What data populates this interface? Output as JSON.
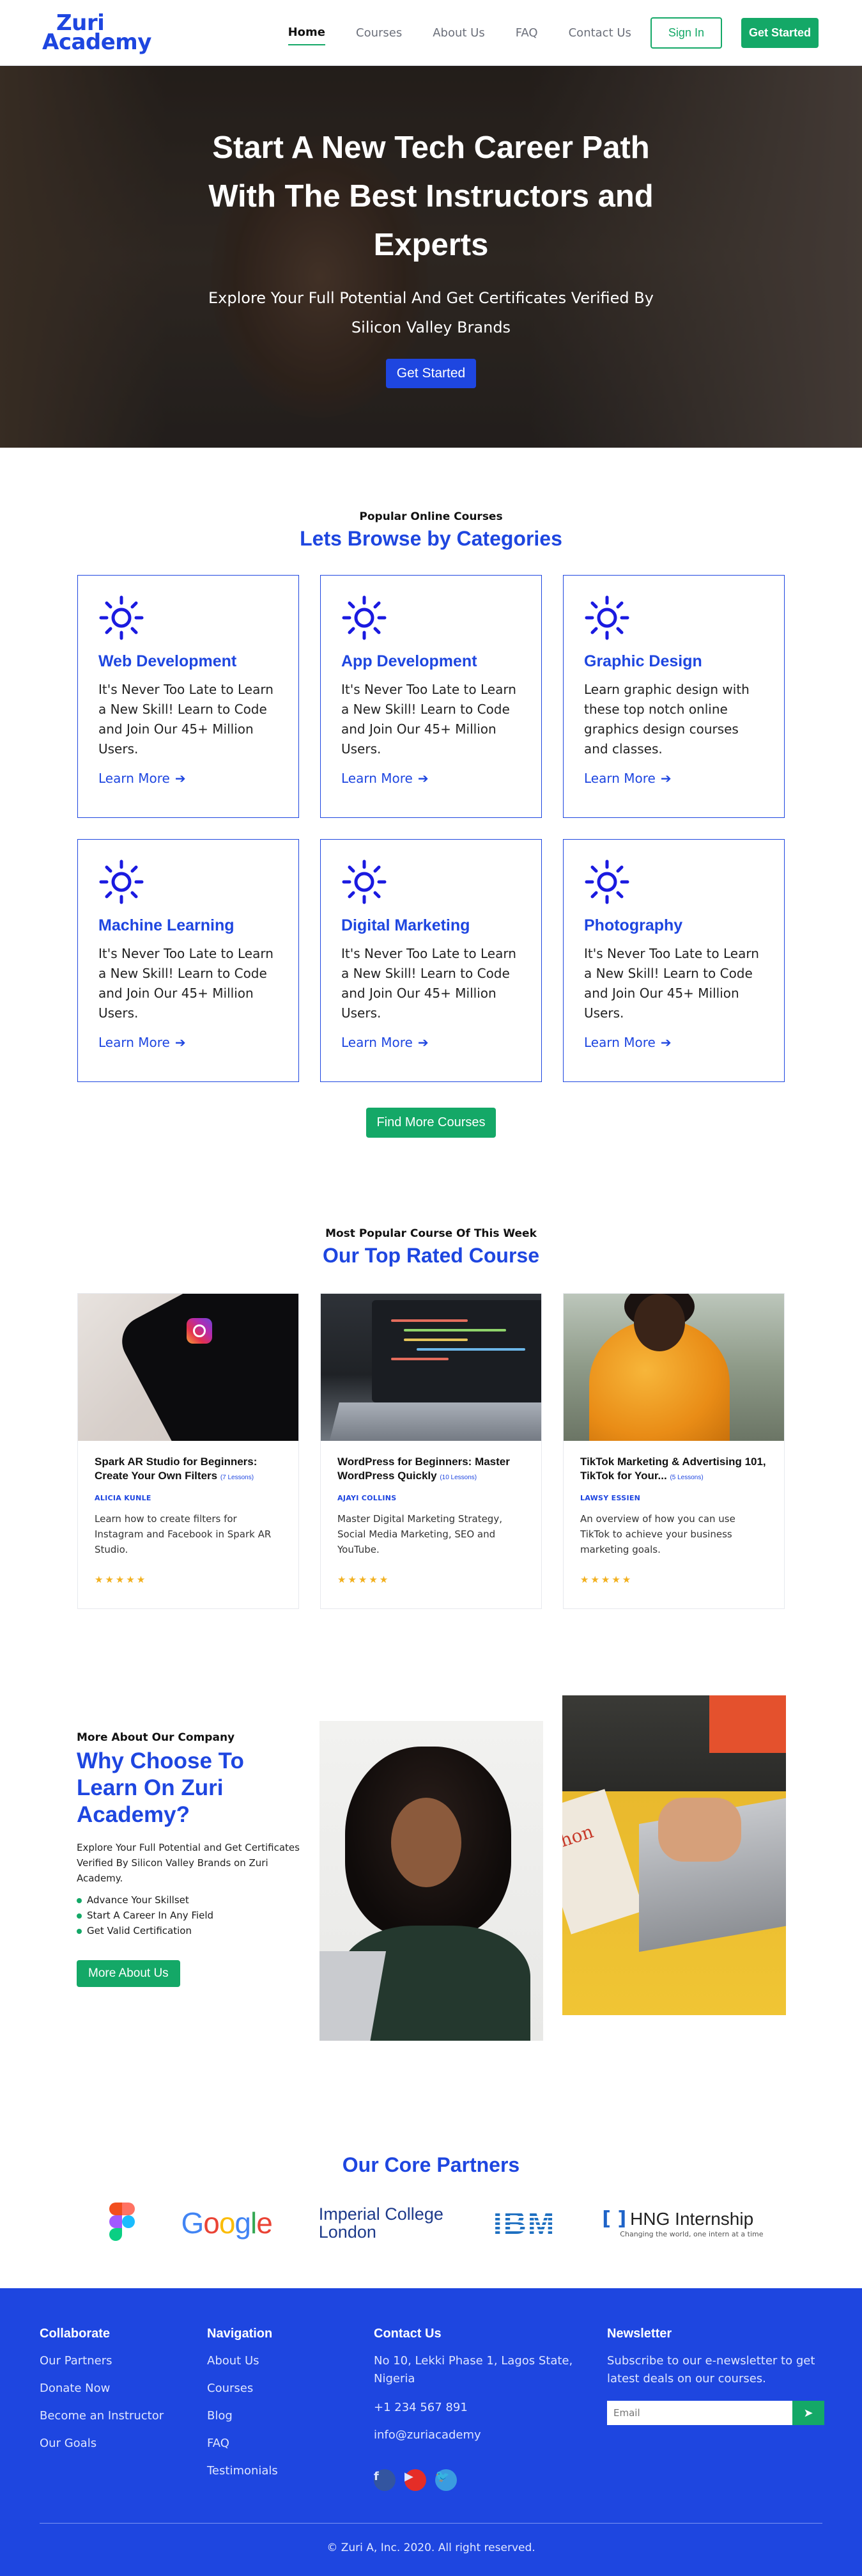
{
  "nav": {
    "logo_line1": "Zuri",
    "logo_line2": "Academy",
    "links": [
      "Home",
      "Courses",
      "About Us",
      "FAQ",
      "Contact Us"
    ],
    "sign_in": "Sign In",
    "get_started": "Get Started"
  },
  "hero": {
    "title": "Start A New Tech Career Path With The Best Instructors and Experts",
    "subtitle": "Explore Your Full Potential And Get Certificates Verified By Silicon Valley Brands",
    "cta": "Get Started"
  },
  "categories": {
    "kicker": "Popular Online Courses",
    "title": "Lets Browse by Categories",
    "learn_more": "Learn More",
    "items": [
      {
        "title": "Web Development",
        "text": "It's Never Too Late to Learn a New Skill! Learn to Code and Join Our 45+ Million Users."
      },
      {
        "title": "App Development",
        "text": "It's Never Too Late to Learn a New Skill! Learn to Code and Join Our 45+ Million Users."
      },
      {
        "title": "Graphic Design",
        "text": "Learn graphic design with these top notch online graphics design courses and classes."
      },
      {
        "title": "Machine Learning",
        "text": "It's Never Too Late to Learn a New Skill! Learn to Code and Join Our 45+ Million Users."
      },
      {
        "title": "Digital Marketing",
        "text": "It's Never Too Late to Learn a New Skill! Learn to Code and Join Our 45+ Million Users."
      },
      {
        "title": "Photography",
        "text": "It's Never Too Late to Learn a New Skill! Learn to Code and Join Our 45+ Million Users."
      }
    ],
    "more_button": "Find More Courses"
  },
  "courses": {
    "kicker": "Most Popular Course Of This Week",
    "title": "Our Top Rated Course",
    "items": [
      {
        "title": "Spark AR Studio for Beginners: Create Your Own Filters",
        "lessons": "(7 Lessons)",
        "author": "ALICIA KUNLE",
        "desc": "Learn how to create filters for Instagram and Facebook in Spark AR Studio.",
        "stars": "★★★★★"
      },
      {
        "title": "WordPress for Beginners: Master WordPress Quickly",
        "lessons": "(10 Lessons)",
        "author": "AJAYI COLLINS",
        "desc": "Master Digital Marketing Strategy, Social Media Marketing, SEO and YouTube.",
        "stars": "★★★★★"
      },
      {
        "title": "TikTok Marketing & Advertising 101, TikTok for Your...",
        "lessons": "(5 Lessons)",
        "author": "LAWSY ESSIEN",
        "desc": "An overview of how you can use TikTok to achieve your business marketing goals.",
        "stars": "★★★★★"
      }
    ]
  },
  "why": {
    "kicker": "More About Our Company",
    "title": "Why Choose To Learn On Zuri Academy?",
    "text": "Explore Your Full Potential and Get Certificates Verified By Silicon Valley Brands on Zuri Academy.",
    "points": [
      "Advance Your Skillset",
      "Start A Career In Any Field",
      "Get Valid Certification"
    ],
    "button": "More About Us",
    "book_text": "thon"
  },
  "partners": {
    "title": "Our Core Partners",
    "google": "Google",
    "imperial": "Imperial College London",
    "ibm": "IBM",
    "hng_name": "HNG Internship",
    "hng_tag": "Changing the world, one intern at a time"
  },
  "footer": {
    "collaborate": {
      "title": "Collaborate",
      "links": [
        "Our Partners",
        "Donate Now",
        "Become an Instructor",
        "Our Goals"
      ]
    },
    "navigation": {
      "title": "Navigation",
      "links": [
        "About Us",
        "Courses",
        "Blog",
        "FAQ",
        "Testimonials"
      ]
    },
    "contact": {
      "title": "Contact Us",
      "address": "No 10, Lekki Phase 1, Lagos State, Nigeria",
      "phone": "+1 234 567 891",
      "email": "info@zuriacademy"
    },
    "newsletter": {
      "title": "Newsletter",
      "text": "Subscribe to our e-newsletter to get latest deals on our courses.",
      "placeholder": "Email"
    },
    "copyright": "© Zuri A, Inc. 2020. All right reserved."
  }
}
